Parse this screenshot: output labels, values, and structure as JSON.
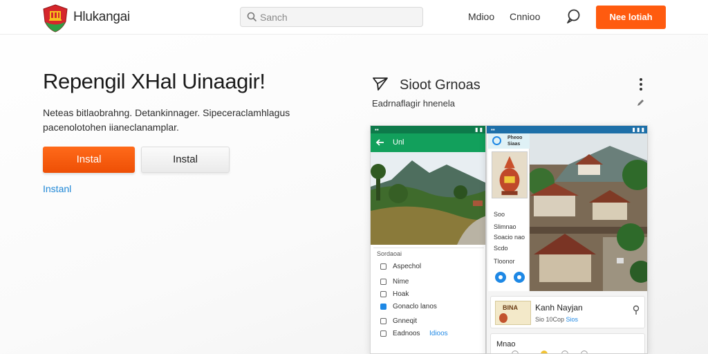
{
  "header": {
    "brand": "Hlukangai",
    "search_placeholder": "Sanch",
    "nav": [
      "Mdioo",
      "Cnnioo"
    ],
    "cta_label": "Nee lotiah"
  },
  "hero": {
    "title": "Repengil XHal Uinaagir!",
    "description": "Neteas bitlaobrahng. Detankinnager. Sipeceraclamhlagus pacenolotohen iianeclanamplar.",
    "primary_button": "Instal",
    "secondary_button": "Instal",
    "link": "Instanl"
  },
  "preview": {
    "title": "Sioot Grnoas",
    "subtitle": "Eadrnaflagir hnenela",
    "phone1": {
      "appbar_title": "Unl",
      "section_header": "Sordaoai",
      "items": [
        "Aspechol",
        "Nime",
        "Hoak",
        "Gonaclo lanos",
        "Gnneqit",
        "Eadnoos"
      ],
      "item_highlight": "Idioos"
    },
    "phone2": {
      "side_title_1": "Pheoo",
      "side_title_2": "Siaas",
      "side_lines": [
        "Soo",
        "Slimnao",
        "Soacio nao",
        "Scdo",
        "Tloonor"
      ],
      "card_name": "Kanh Nayjan",
      "card_meta": "Sio 10Cop",
      "card_meta_link": "Sios",
      "card_thumb_text": "BINA",
      "card2_name": "Mnao"
    }
  },
  "colors": {
    "accent": "#ff5b0f",
    "link": "#1f87d6",
    "appbar_green": "#12a05c",
    "statusbar_blue": "#1d6fa8"
  },
  "icons": {
    "logo": "shield-logo-icon",
    "search": "search-icon",
    "chat": "chat-bubble-icon",
    "send": "send-icon",
    "more": "kebab-menu-icon",
    "edit": "pencil-icon",
    "back": "arrow-left-icon",
    "pin": "map-pin-icon"
  }
}
